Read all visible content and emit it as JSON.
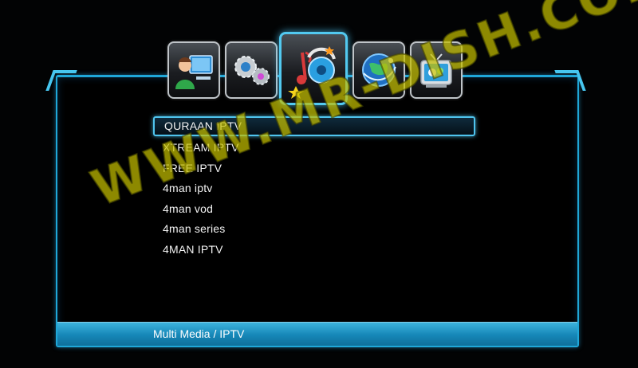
{
  "menu_icons": [
    {
      "name": "system-setup-icon",
      "selected": false
    },
    {
      "name": "settings-gears-icon",
      "selected": false
    },
    {
      "name": "multimedia-music-icon",
      "selected": true
    },
    {
      "name": "network-globe-icon",
      "selected": false
    },
    {
      "name": "tv-channels-icon",
      "selected": false
    }
  ],
  "iptv_list": {
    "selected_index": 0,
    "items": [
      "QURAAN IPTV",
      "XTREAM IPTV",
      "FREE IPTV",
      "4man iptv",
      "4man vod",
      "4man series",
      "4MAN IPTV"
    ]
  },
  "status_bar": {
    "breadcrumb": "Multi Media / IPTV"
  },
  "watermark": {
    "text": "WWW.MR-DISH.COM"
  },
  "colors": {
    "accent": "#4fc4ee",
    "status_bar": "#1a8fc2",
    "watermark": "#c4be00"
  }
}
